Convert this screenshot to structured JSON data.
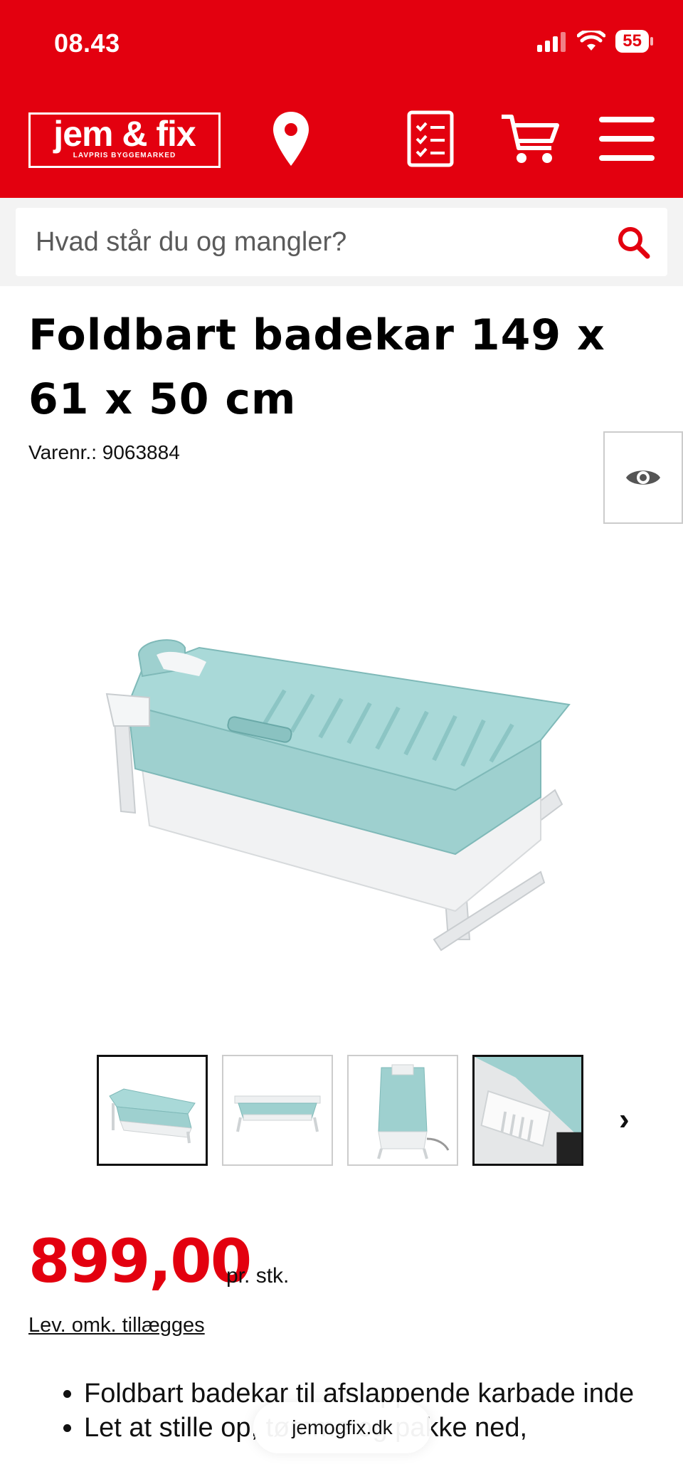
{
  "status_bar": {
    "time": "08.43",
    "battery": "55"
  },
  "header": {
    "logo_main": "jem & fix",
    "logo_sub": "LAVPRIS BYGGEMARKED",
    "icons": [
      "location-pin-icon",
      "shopping-list-icon",
      "cart-icon",
      "menu-icon"
    ],
    "brand_color": "#e3000f"
  },
  "search": {
    "placeholder": "Hvad står du og mangler?"
  },
  "product": {
    "title": "Foldbart badekar 149 x 61 x 50 cm",
    "sku": "Varenr.: 9063884",
    "thumbnail_count": 4,
    "active_thumbnail": 1,
    "price": "899,00",
    "price_unit": "pr. stk.",
    "shipping_note": "Lev. omk. tillægges",
    "bullets": [
      "Foldbart badekar til afslappende karbade inde",
      "Let at stille op, tømme og pakke ned,"
    ]
  },
  "browser": {
    "url": "jemogfix.dk"
  }
}
